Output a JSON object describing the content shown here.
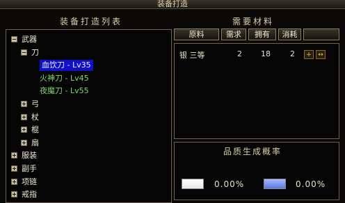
{
  "window": {
    "title": "装备打造"
  },
  "left": {
    "header": "装备打造列表",
    "tree": [
      {
        "label": "武器",
        "state": "expanded",
        "color": "#eee8d2"
      },
      {
        "label": "刀",
        "state": "expanded",
        "color": "#eee8d2"
      },
      {
        "label": "血饮刀 - Lv35",
        "state": "selected",
        "color": "#f0f0ff"
      },
      {
        "label": "火神刀 - Lv45",
        "state": "leaf",
        "color": "#7fd86e"
      },
      {
        "label": "夜魔刀 - Lv55",
        "state": "leaf",
        "color": "#7fd86e"
      },
      {
        "label": "弓",
        "state": "collapsed",
        "color": "#eee8d2"
      },
      {
        "label": "杖",
        "state": "collapsed",
        "color": "#eee8d2"
      },
      {
        "label": "棍",
        "state": "collapsed",
        "color": "#eee8d2"
      },
      {
        "label": "扇",
        "state": "collapsed",
        "color": "#eee8d2"
      },
      {
        "label": "服装",
        "state": "collapsed",
        "color": "#eee8d2"
      },
      {
        "label": "副手",
        "state": "collapsed",
        "color": "#eee8d2"
      },
      {
        "label": "项链",
        "state": "collapsed",
        "color": "#eee8d2"
      },
      {
        "label": "戒指",
        "state": "collapsed",
        "color": "#eee8d2"
      }
    ]
  },
  "materials": {
    "header": "需要材料",
    "columns": [
      "原料",
      "需求",
      "拥有",
      "消耗"
    ],
    "rows": [
      {
        "name": "银 三等",
        "need": "2",
        "have": "18",
        "consume": "2"
      }
    ],
    "buttons": {
      "plus": "+",
      "arrows": "↔"
    }
  },
  "quality": {
    "header": "品质生成概率",
    "items": [
      {
        "color": "#e8e8e8",
        "percent": "0.00%"
      },
      {
        "color": "#5a78e0",
        "percent": "0.00%"
      }
    ]
  }
}
